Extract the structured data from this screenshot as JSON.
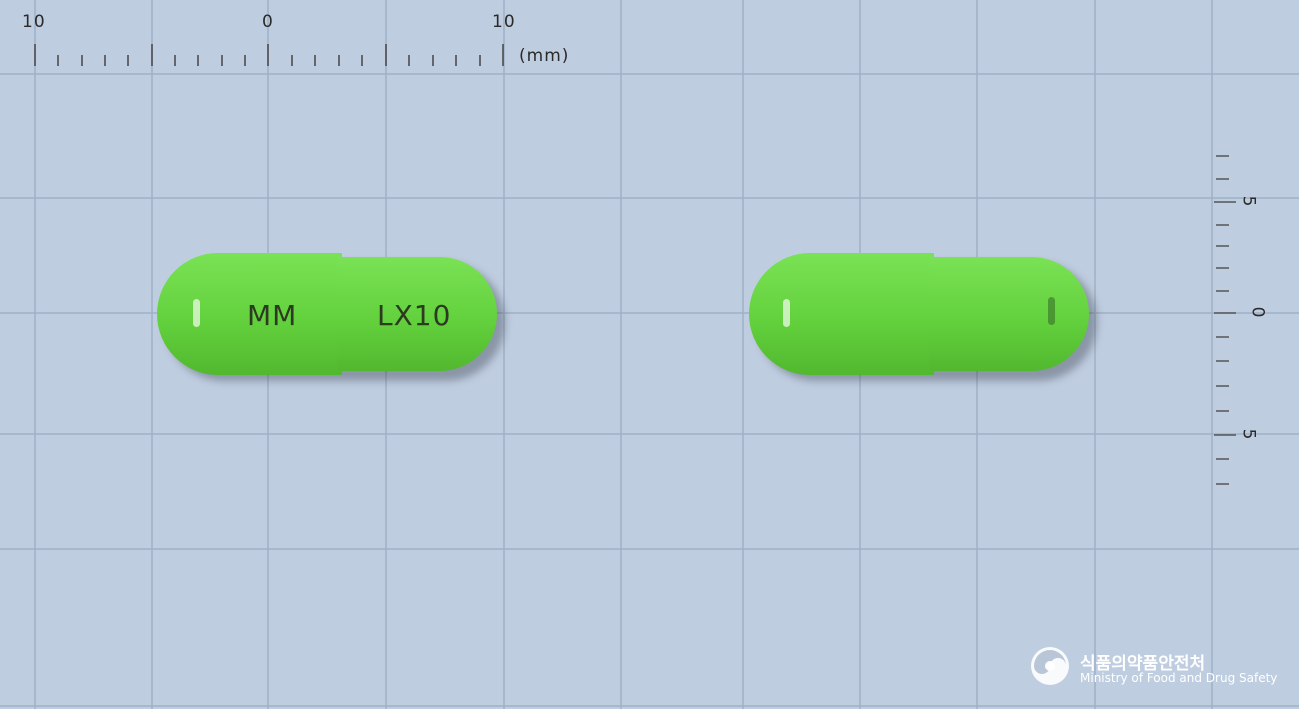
{
  "ruler_top": {
    "labels": [
      "10",
      "0",
      "10"
    ],
    "unit": "(mm)"
  },
  "ruler_right": {
    "labels": [
      "5",
      "0",
      "5"
    ]
  },
  "pills": [
    {
      "imprint_left": "MM",
      "imprint_right": "LX10"
    },
    {
      "imprint_left": "",
      "imprint_right": ""
    }
  ],
  "colors": {
    "background": "#bfcde0",
    "capsule": "#6fd94a",
    "imprint": "#2c3b1f"
  },
  "watermark": {
    "name_ko": "식품의약품안전처",
    "name_en": "Ministry of Food and Drug Safety"
  }
}
